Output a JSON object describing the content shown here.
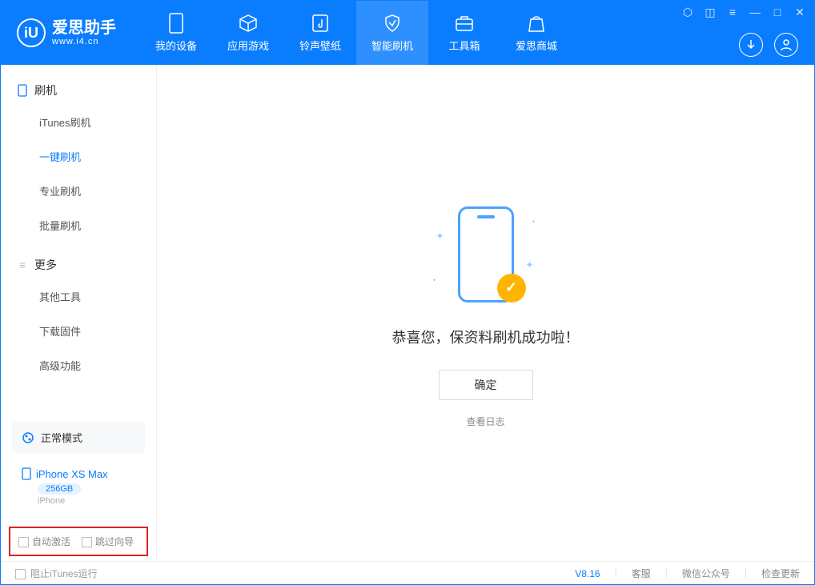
{
  "app": {
    "title": "爱思助手",
    "subtitle": "www.i4.cn"
  },
  "nav": {
    "items": [
      {
        "label": "我的设备"
      },
      {
        "label": "应用游戏"
      },
      {
        "label": "铃声壁纸"
      },
      {
        "label": "智能刷机"
      },
      {
        "label": "工具箱"
      },
      {
        "label": "爱思商城"
      }
    ]
  },
  "sidebar": {
    "group1_title": "刷机",
    "group1": [
      {
        "label": "iTunes刷机"
      },
      {
        "label": "一键刷机"
      },
      {
        "label": "专业刷机"
      },
      {
        "label": "批量刷机"
      }
    ],
    "group2_title": "更多",
    "group2": [
      {
        "label": "其他工具"
      },
      {
        "label": "下载固件"
      },
      {
        "label": "高级功能"
      }
    ],
    "mode_label": "正常模式",
    "device_name": "iPhone XS Max",
    "device_storage": "256GB",
    "device_type": "iPhone",
    "checkbox1": "自动激活",
    "checkbox2": "跳过向导"
  },
  "main": {
    "success_text": "恭喜您，保资料刷机成功啦！",
    "ok_button": "确定",
    "log_link": "查看日志"
  },
  "footer": {
    "block_itunes": "阻止iTunes运行",
    "version": "V8.16",
    "links": [
      "客服",
      "微信公众号",
      "检查更新"
    ]
  }
}
